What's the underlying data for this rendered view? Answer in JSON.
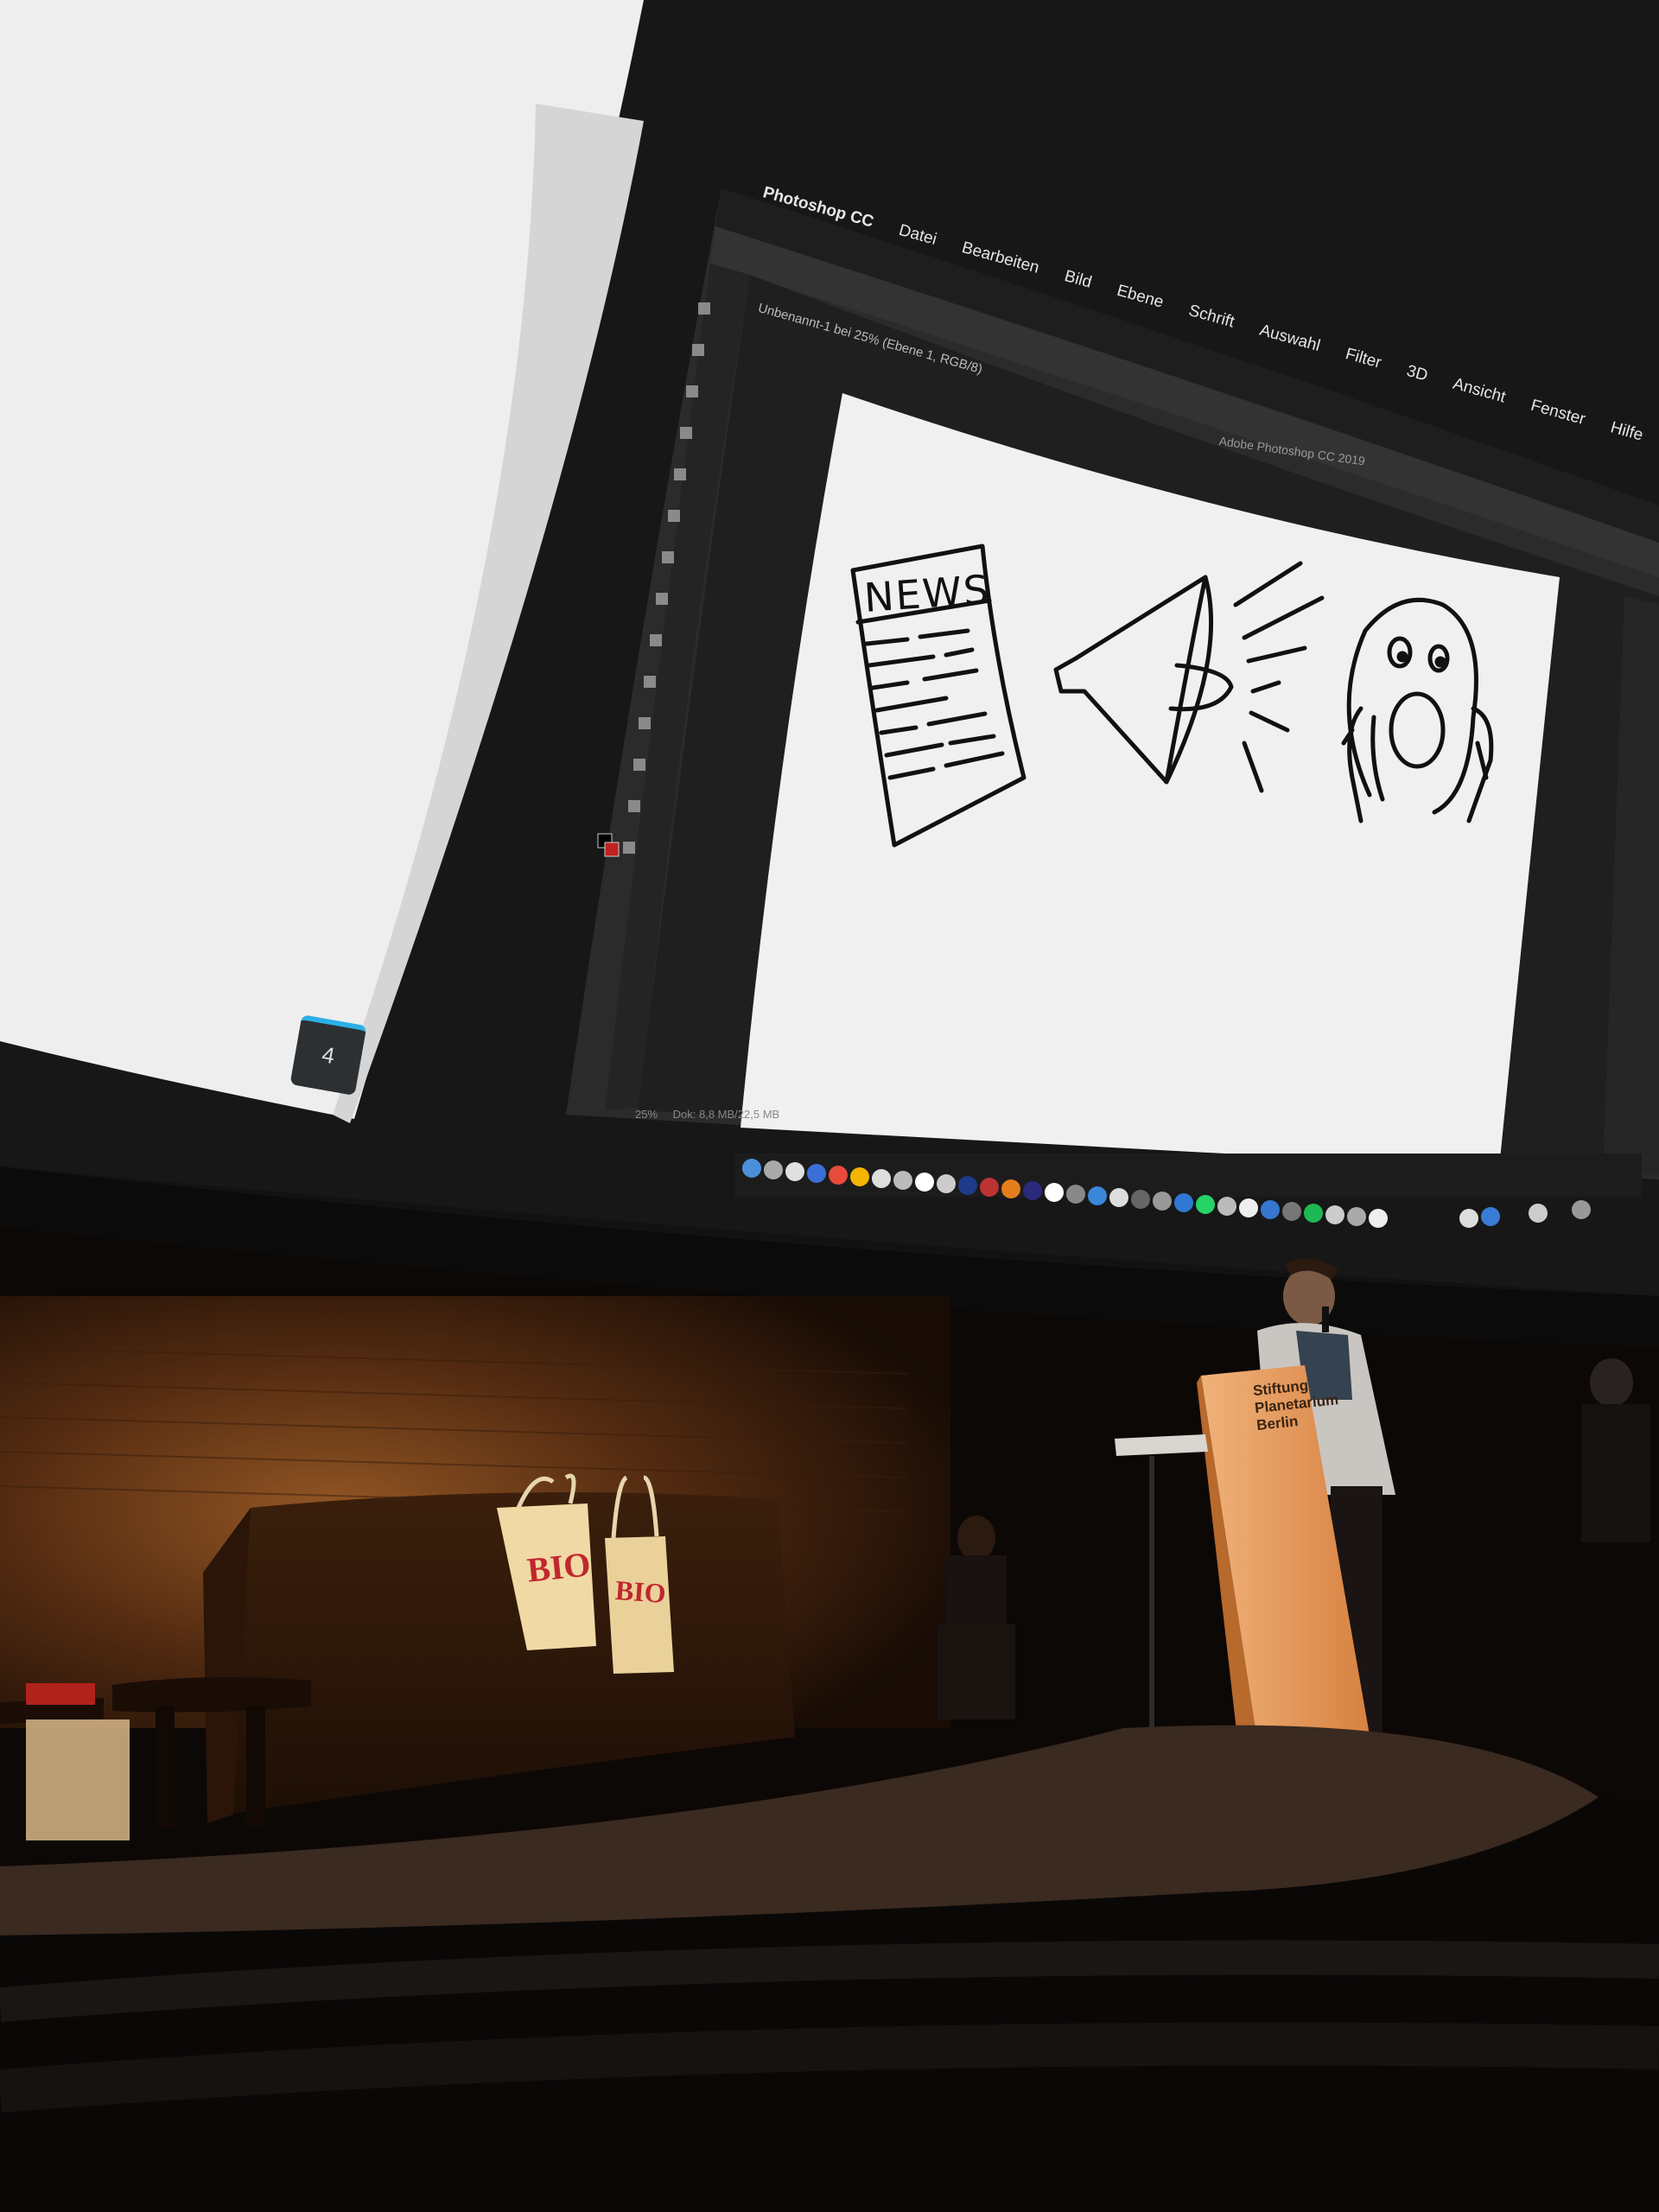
{
  "photoshop": {
    "menu": {
      "apple": "",
      "app": "Photoshop CC",
      "items": [
        "Datei",
        "Bearbeiten",
        "Bild",
        "Ebene",
        "Schrift",
        "Auswahl",
        "Filter",
        "3D",
        "Ansicht",
        "Fenster",
        "Hilfe"
      ]
    },
    "window_title": "Adobe Photoshop CC 2019",
    "document_tab": "Unbenannt-1 bei 25% (Ebene 1, RGB/8)",
    "status": {
      "zoom": "25%",
      "doc_size": "Dok: 8,8 MB/22,5 MB"
    }
  },
  "drawing": {
    "news_text": "NEWS"
  },
  "presentation": {
    "slide_number": "4"
  },
  "stage": {
    "lectern_lines": [
      "Stiftung",
      "Planetarium",
      "Berlin"
    ],
    "bag_logo": "BIO"
  },
  "colors": {
    "dome_dark": "#141414",
    "canvas_white": "#f2f2f2",
    "stage_orange": "#8a4a1c",
    "lectern": "#e89a5a",
    "dock_bar": "#1c1c1c"
  }
}
